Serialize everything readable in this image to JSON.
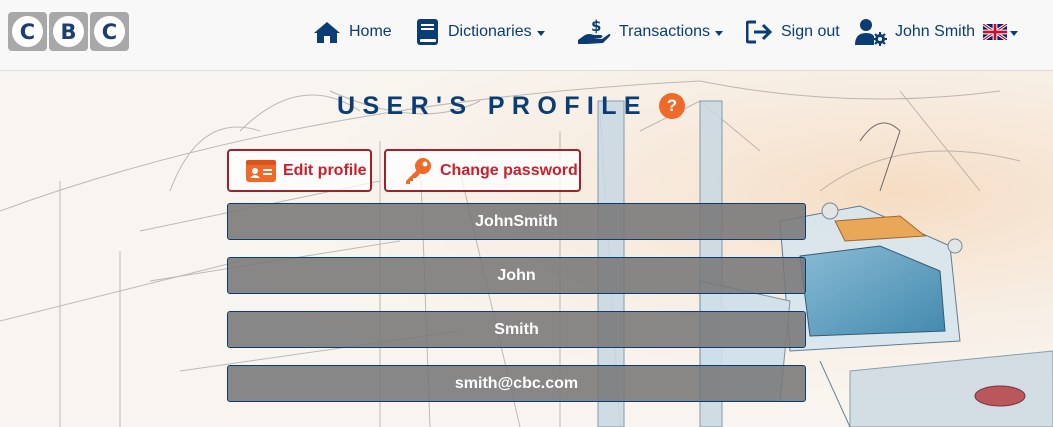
{
  "logo": {
    "letters": [
      "C",
      "B",
      "C"
    ]
  },
  "nav": {
    "home": "Home",
    "dictionaries": "Dictionaries",
    "transactions": "Transactions",
    "sign_out": "Sign out",
    "user": "John Smith"
  },
  "page": {
    "title": "USER'S PROFILE",
    "help": "?"
  },
  "actions": {
    "edit_profile": "Edit profile",
    "change_password": "Change password"
  },
  "profile": {
    "username": "JohnSmith",
    "first_name": "John",
    "last_name": "Smith",
    "email": "smith@cbc.com"
  },
  "colors": {
    "brand_blue": "#0b3d74",
    "accent_red": "#c8202f",
    "help_orange": "#ef6a2a",
    "field_gray": "#7a7a7a"
  },
  "icons": {
    "home": "home-icon",
    "dictionaries": "book-icon",
    "transactions": "hand-dollar-icon",
    "sign_out": "sign-out-icon",
    "user": "user-gear-icon",
    "language": "uk-flag-icon",
    "edit_profile": "id-card-icon",
    "change_password": "key-icon"
  }
}
